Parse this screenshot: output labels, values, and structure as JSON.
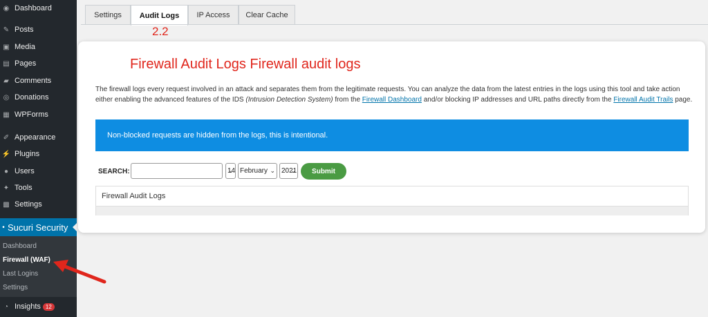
{
  "sidebar": {
    "items": [
      {
        "label": "Dashboard",
        "icon": "dashboard-icon"
      },
      {
        "label": "Posts",
        "icon": "pin-icon"
      },
      {
        "label": "Media",
        "icon": "media-icon"
      },
      {
        "label": "Pages",
        "icon": "pages-icon"
      },
      {
        "label": "Comments",
        "icon": "comments-icon"
      },
      {
        "label": "Donations",
        "icon": "donations-icon"
      },
      {
        "label": "WPForms",
        "icon": "forms-icon"
      },
      {
        "label": "Appearance",
        "icon": "brush-icon"
      },
      {
        "label": "Plugins",
        "icon": "plugin-icon"
      },
      {
        "label": "Users",
        "icon": "users-icon"
      },
      {
        "label": "Tools",
        "icon": "wrench-icon"
      },
      {
        "label": "Settings",
        "icon": "settings-icon"
      }
    ],
    "current": {
      "label": "Sucuri Security"
    },
    "submenu": [
      "Dashboard",
      "Firewall (WAF)",
      "Last Logins",
      "Settings"
    ],
    "insights": {
      "label": "Insights",
      "badge": "12"
    }
  },
  "tabs": [
    "Settings",
    "Audit Logs",
    "IP Access",
    "Clear Cache"
  ],
  "annotation_step": "2.2",
  "card": {
    "title": "Firewall Audit Logs Firewall audit logs",
    "desc_1": "The firewall logs every request involved in an attack and separates them from the legitimate requests. You can analyze the data from the latest entries in the logs using this tool and take action either enabling the advanced features of the IDS ",
    "desc_ids": "(Intrusion Detection System)",
    "desc_2": " from the ",
    "desc_link1": "Firewall Dashboard",
    "desc_3": " and/or blocking IP addresses and URL paths directly from the ",
    "desc_link2": "Firewall Audit Trails",
    "desc_4": " page.",
    "notice": "Non-blocked requests are hidden from the logs, this is intentional."
  },
  "search": {
    "label": "SEARCH:",
    "value": "",
    "day": "14",
    "month": "February",
    "year": "2021",
    "submit": "Submit"
  },
  "table": {
    "header": "Firewall Audit Logs"
  },
  "colors": {
    "accent": "#0073aa",
    "annotation": "#e0261c",
    "notice": "#0e8de2",
    "submit": "#4a9b43"
  }
}
